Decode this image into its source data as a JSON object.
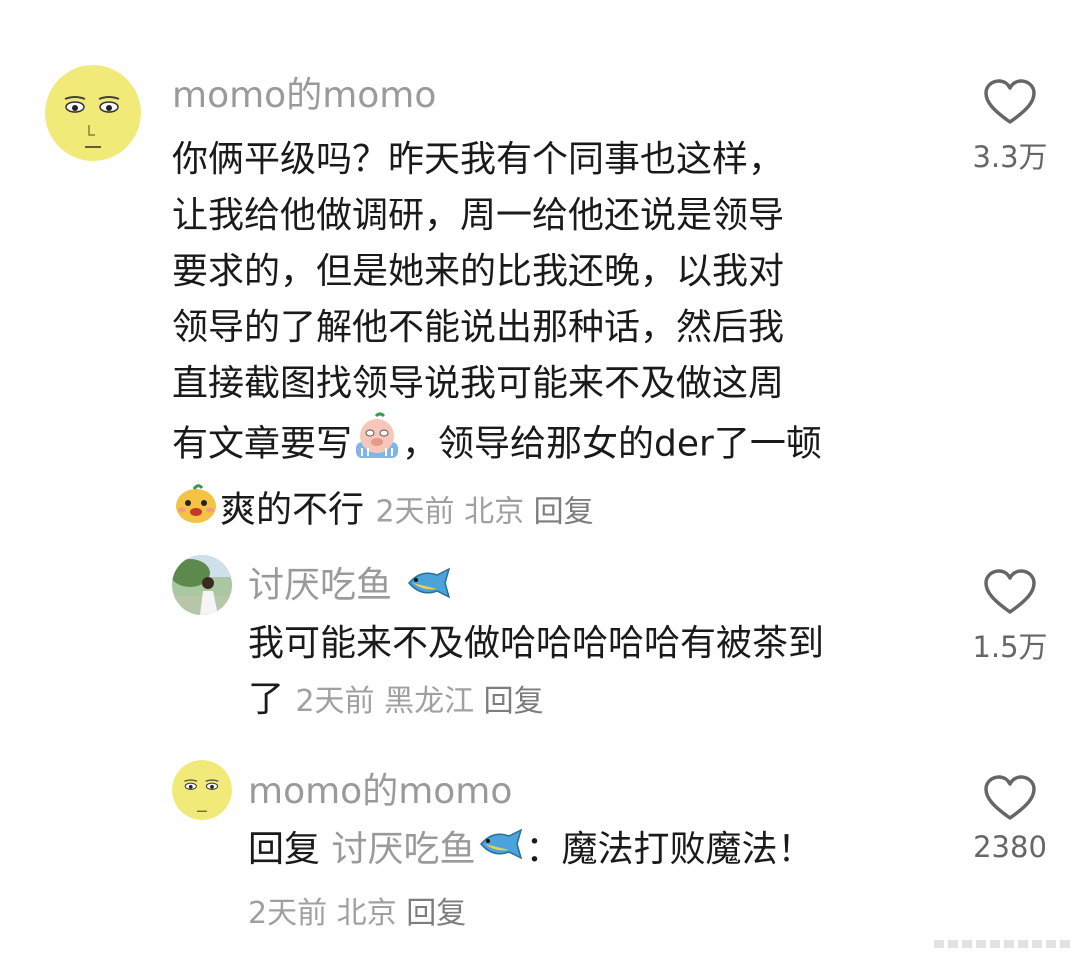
{
  "comments": [
    {
      "username": "momo的momo",
      "text_lines": [
        "你俩平级吗？昨天我有个同事也这样，",
        "让我给他做调研，周一给他还说是领导",
        "要求的，但是她来的比我还晚，以我对",
        "领导的了解他不能说出那种话，然后我",
        "直接截图找领导说我可能来不及做这周",
        "有文章要写",
        "，领导给那女的der了一顿",
        "爽的不行"
      ],
      "time": "2天前",
      "location": "北京",
      "reply_label": "回复",
      "likes": "3.3万",
      "avatar_icon": "yellow-face-avatar",
      "emojis": [
        "crying-pig-emoji",
        "happy-dog-emoji"
      ]
    },
    {
      "username": "讨厌吃鱼",
      "username_icon": "fish-icon",
      "text_lines": [
        "我可能来不及做哈哈哈哈哈有被茶到",
        "了"
      ],
      "time": "2天前",
      "location": "黑龙江",
      "reply_label": "回复",
      "likes": "1.5万",
      "avatar_icon": "photo-avatar"
    },
    {
      "username": "momo的momo",
      "reply_prefix": "回复",
      "reply_to": "讨厌吃鱼",
      "reply_text": "：魔法打败魔法！",
      "time": "2天前",
      "location": "北京",
      "reply_label": "回复",
      "likes": "2380",
      "avatar_icon": "yellow-face-avatar"
    }
  ],
  "colors": {
    "text": "#1a1a1a",
    "username": "#9a9a9a",
    "meta": "#a0a0a0"
  }
}
